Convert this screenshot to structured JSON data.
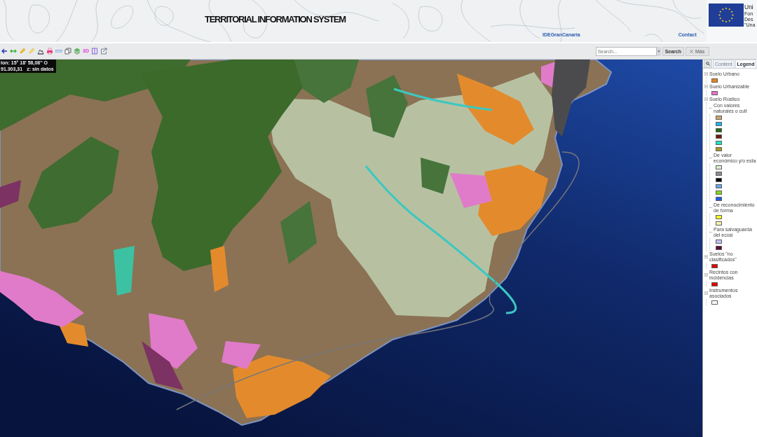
{
  "header": {
    "title": "TERRITORIAL INFORMATION SYSTEM",
    "links": [
      "IDEGranCanaria",
      "Contact"
    ],
    "logo_lines": [
      "Uni",
      "Fon",
      "Des",
      "\"Una"
    ]
  },
  "toolbar": {
    "tools": [
      {
        "kind": "back"
      },
      {
        "kind": "pan"
      },
      {
        "kind": "edit"
      },
      {
        "kind": "highlight"
      },
      {
        "kind": "profile"
      },
      {
        "kind": "print"
      },
      {
        "kind": "measure"
      },
      {
        "kind": "copy"
      },
      {
        "kind": "layers"
      },
      {
        "kind": "label",
        "label": "3D"
      },
      {
        "kind": "panel"
      },
      {
        "kind": "export"
      }
    ],
    "search": {
      "placeholder": "Search...",
      "button": "Search",
      "clear_button": "Más"
    }
  },
  "map": {
    "coordinate_lines": [
      [
        "lon: 15° 18' 58,08'' O"
      ],
      [
        "91.303,31",
        "z: sin datos"
      ]
    ]
  },
  "legend_panel": {
    "tabs": [
      {
        "label": "Content",
        "selected": false
      },
      {
        "label": "Legend",
        "selected": true
      }
    ],
    "items": [
      {
        "kind": "group",
        "label": "Suelo Urbano",
        "expanded": true,
        "children": [
          {
            "kind": "swatch",
            "color": "#e8831e"
          }
        ]
      },
      {
        "kind": "group",
        "label": "Suelo Urbanizable",
        "expanded": true,
        "children": [
          {
            "kind": "swatch",
            "color": "#ea6fd2"
          }
        ]
      },
      {
        "kind": "group",
        "label": "Suelo Rústico",
        "expanded": true,
        "children": [
          {
            "kind": "category",
            "label": "Con valores naturales o cult",
            "children": [
              {
                "kind": "swatch",
                "color": "#c9a46c"
              },
              {
                "kind": "swatch",
                "color": "#1cb4ea"
              },
              {
                "kind": "swatch",
                "color": "#1f6a12"
              },
              {
                "kind": "swatch",
                "color": "#6e1e0c"
              },
              {
                "kind": "swatch",
                "color": "#1ce4c2"
              },
              {
                "kind": "swatch",
                "color": "#aa9a22"
              }
            ]
          },
          {
            "kind": "category",
            "label": "De valor económico y/o esta",
            "children": [
              {
                "kind": "swatch",
                "color": "#daeecb"
              },
              {
                "kind": "swatch",
                "color": "#8c8c8c"
              },
              {
                "kind": "swatch",
                "color": "#000000"
              },
              {
                "kind": "swatch",
                "color": "#6ca2ea"
              },
              {
                "kind": "swatch",
                "color": "#88d61c"
              },
              {
                "kind": "swatch",
                "color": "#1c5ce2"
              }
            ]
          },
          {
            "kind": "category",
            "label": "De reconocimiento de forma",
            "children": [
              {
                "kind": "swatch",
                "color": "#f6f61c"
              },
              {
                "kind": "swatch",
                "color": "#f6f1b2"
              }
            ]
          },
          {
            "kind": "category",
            "label": "Para salvaguarda del ecosi",
            "children": [
              {
                "kind": "swatch",
                "color": "#c2c2f2"
              },
              {
                "kind": "swatch",
                "color": "#5c0c3c"
              }
            ]
          }
        ]
      },
      {
        "kind": "group",
        "label": "Suelos \"no clasificados\"",
        "expanded": true,
        "children": [
          {
            "kind": "swatch",
            "color": "#e20000"
          }
        ]
      },
      {
        "kind": "group",
        "label": "Recintos con incidencias",
        "expanded": true,
        "children": [
          {
            "kind": "swatch",
            "color": "#e20202"
          }
        ]
      },
      {
        "kind": "group",
        "label": "Instrumentos asociados",
        "expanded": true,
        "children": [
          {
            "kind": "swatch",
            "color": "#ffffff"
          }
        ]
      }
    ]
  }
}
